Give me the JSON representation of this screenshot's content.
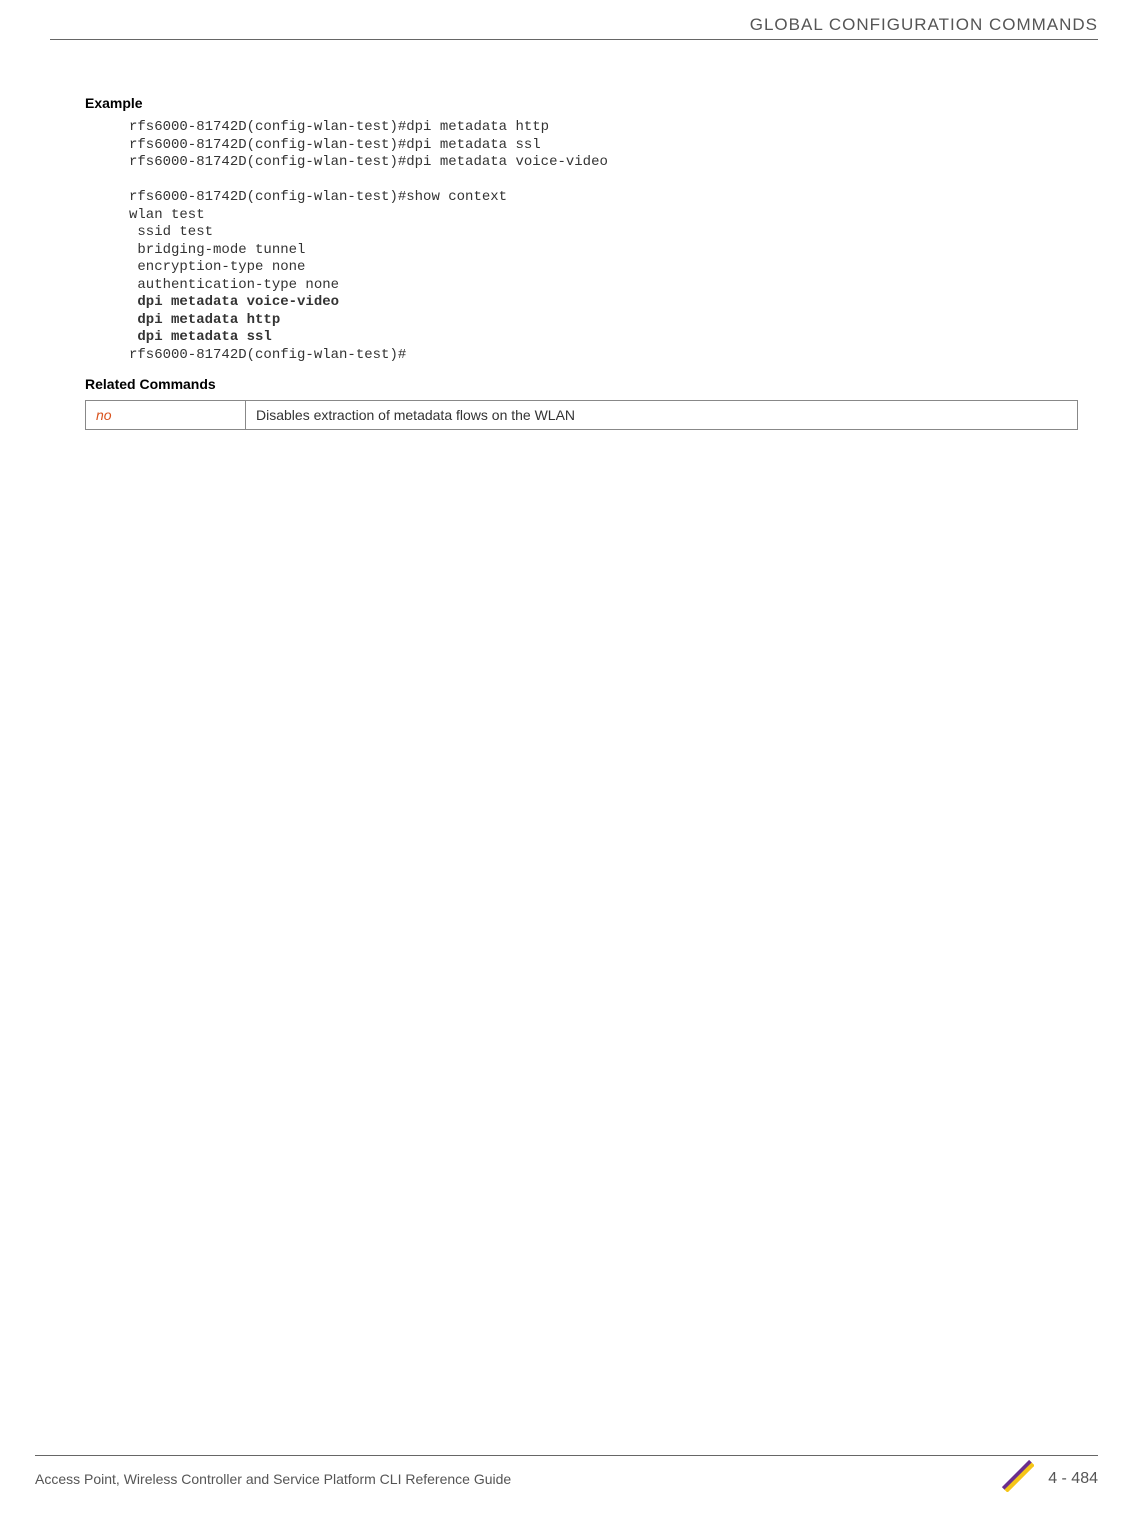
{
  "header": {
    "title": "GLOBAL CONFIGURATION COMMANDS"
  },
  "sections": {
    "example_heading": "Example",
    "code_lines": [
      "rfs6000-81742D(config-wlan-test)#dpi metadata http",
      "rfs6000-81742D(config-wlan-test)#dpi metadata ssl",
      "rfs6000-81742D(config-wlan-test)#dpi metadata voice-video",
      "",
      "rfs6000-81742D(config-wlan-test)#show context",
      "wlan test",
      " ssid test",
      " bridging-mode tunnel",
      " encryption-type none",
      " authentication-type none"
    ],
    "code_bold_lines": [
      " dpi metadata voice-video",
      " dpi metadata http",
      " dpi metadata ssl"
    ],
    "code_tail": "rfs6000-81742D(config-wlan-test)#",
    "related_heading": "Related Commands",
    "related_row": {
      "cmd": "no",
      "desc": "Disables extraction of metadata flows on the WLAN"
    }
  },
  "footer": {
    "left": "Access Point, Wireless Controller and Service Platform CLI Reference Guide",
    "page": "4 - 484"
  }
}
